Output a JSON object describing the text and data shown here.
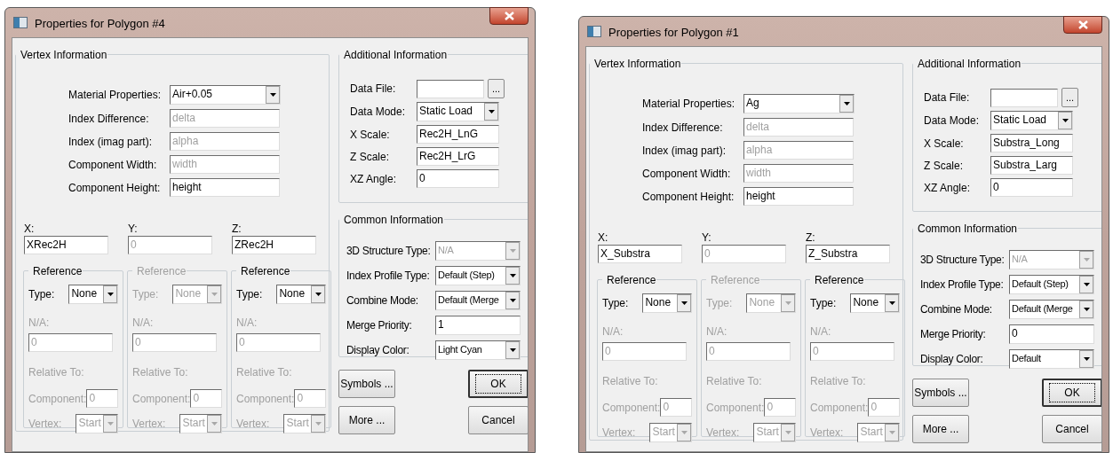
{
  "dialogs": [
    {
      "title": "Properties for Polygon #4",
      "vertex_info": {
        "title": "Vertex Information",
        "fields": [
          {
            "label": "Material Properties:",
            "kind": "dropdown",
            "value": "Air+0.05",
            "disabled": false
          },
          {
            "label": "Index Difference:",
            "kind": "text",
            "value": "delta",
            "disabled": true
          },
          {
            "label": "Index (imag part):",
            "kind": "text",
            "value": "alpha",
            "disabled": true
          },
          {
            "label": "Component Width:",
            "kind": "text",
            "value": "width",
            "disabled": true
          },
          {
            "label": "Component Height:",
            "kind": "text",
            "value": "height",
            "disabled": false
          }
        ],
        "coords": [
          {
            "label": "X:",
            "value": "XRec2H",
            "disabled": false,
            "reference": {
              "title": "Reference",
              "disabled": false,
              "rows": [
                {
                  "kind": "dropdown",
                  "label": "Type:",
                  "value": "None",
                  "disabled": false
                },
                {
                  "kind": "stacked",
                  "label": "N/A:",
                  "value": "0",
                  "disabled": true
                },
                {
                  "kind": "label",
                  "label": "Relative To:",
                  "disabled": true
                },
                {
                  "kind": "inline",
                  "label": "Component:",
                  "value": "0",
                  "disabled": true
                },
                {
                  "kind": "dropdown",
                  "label": "Vertex:",
                  "value": "Start",
                  "disabled": true
                }
              ]
            }
          },
          {
            "label": "Y:",
            "value": "0",
            "disabled": true,
            "reference": {
              "title": "Reference",
              "disabled": true,
              "rows": [
                {
                  "kind": "dropdown",
                  "label": "Type:",
                  "value": "None",
                  "disabled": true
                },
                {
                  "kind": "stacked",
                  "label": "N/A:",
                  "value": "0",
                  "disabled": true
                },
                {
                  "kind": "label",
                  "label": "Relative To:",
                  "disabled": true
                },
                {
                  "kind": "inline",
                  "label": "Component:",
                  "value": "0",
                  "disabled": true
                },
                {
                  "kind": "dropdown",
                  "label": "Vertex:",
                  "value": "Start",
                  "disabled": true
                }
              ]
            }
          },
          {
            "label": "Z:",
            "value": "ZRec2H",
            "disabled": false,
            "reference": {
              "title": "Reference",
              "disabled": false,
              "rows": [
                {
                  "kind": "dropdown",
                  "label": "Type:",
                  "value": "None",
                  "disabled": false
                },
                {
                  "kind": "stacked",
                  "label": "N/A:",
                  "value": "0",
                  "disabled": true
                },
                {
                  "kind": "label",
                  "label": "Relative To:",
                  "disabled": true
                },
                {
                  "kind": "inline",
                  "label": "Component:",
                  "value": "0",
                  "disabled": true
                },
                {
                  "kind": "dropdown",
                  "label": "Vertex:",
                  "value": "Start",
                  "disabled": true
                }
              ]
            }
          }
        ]
      },
      "additional_info": {
        "title": "Additional Information",
        "fields": [
          {
            "label": "Data File:",
            "kind": "file",
            "browse": "..."
          },
          {
            "label": "Data Mode:",
            "kind": "dropdown",
            "value": "Static Load"
          },
          {
            "label": "X Scale:",
            "kind": "text",
            "value": "Rec2H_LnG"
          },
          {
            "label": "Z Scale:",
            "kind": "text",
            "value": "Rec2H_LrG"
          },
          {
            "label": "XZ Angle:",
            "kind": "text",
            "value": "0"
          }
        ]
      },
      "common_info": {
        "title": "Common Information",
        "fields": [
          {
            "label": "3D Structure Type:",
            "kind": "dropdown",
            "value": "N/A",
            "disabled": true
          },
          {
            "label": "Index Profile Type:",
            "kind": "dropdown",
            "value": "Default (Step)",
            "disabled": false
          },
          {
            "label": "Combine Mode:",
            "kind": "dropdown",
            "value": "Default (Merge",
            "disabled": false
          },
          {
            "label": "Merge Priority:",
            "kind": "text",
            "value": "1",
            "disabled": false
          },
          {
            "label": "Display Color:",
            "kind": "dropdown",
            "value": "Light Cyan",
            "disabled": false
          }
        ]
      },
      "buttons": [
        {
          "label": "Symbols ...",
          "default": false
        },
        {
          "label": "OK",
          "default": true
        },
        {
          "label": "More ...",
          "default": false
        },
        {
          "label": "Cancel",
          "default": false
        }
      ]
    },
    {
      "title": "Properties for Polygon #1",
      "vertex_info": {
        "title": "Vertex Information",
        "fields": [
          {
            "label": "Material Properties:",
            "kind": "dropdown",
            "value": "Ag",
            "disabled": false
          },
          {
            "label": "Index Difference:",
            "kind": "text",
            "value": "delta",
            "disabled": true
          },
          {
            "label": "Index (imag part):",
            "kind": "text",
            "value": "alpha",
            "disabled": true
          },
          {
            "label": "Component Width:",
            "kind": "text",
            "value": "width",
            "disabled": true
          },
          {
            "label": "Component Height:",
            "kind": "text",
            "value": "height",
            "disabled": false
          }
        ],
        "coords": [
          {
            "label": "X:",
            "value": "X_Substra",
            "disabled": false,
            "reference": {
              "title": "Reference",
              "disabled": false,
              "rows": [
                {
                  "kind": "dropdown",
                  "label": "Type:",
                  "value": "None",
                  "disabled": false
                },
                {
                  "kind": "stacked",
                  "label": "N/A:",
                  "value": "0",
                  "disabled": true
                },
                {
                  "kind": "label",
                  "label": "Relative To:",
                  "disabled": true
                },
                {
                  "kind": "inline",
                  "label": "Component:",
                  "value": "0",
                  "disabled": true
                },
                {
                  "kind": "dropdown",
                  "label": "Vertex:",
                  "value": "Start",
                  "disabled": true
                }
              ]
            }
          },
          {
            "label": "Y:",
            "value": "0",
            "disabled": true,
            "reference": {
              "title": "Reference",
              "disabled": true,
              "rows": [
                {
                  "kind": "dropdown",
                  "label": "Type:",
                  "value": "None",
                  "disabled": true
                },
                {
                  "kind": "stacked",
                  "label": "N/A:",
                  "value": "0",
                  "disabled": true
                },
                {
                  "kind": "label",
                  "label": "Relative To:",
                  "disabled": true
                },
                {
                  "kind": "inline",
                  "label": "Component:",
                  "value": "0",
                  "disabled": true
                },
                {
                  "kind": "dropdown",
                  "label": "Vertex:",
                  "value": "Start",
                  "disabled": true
                }
              ]
            }
          },
          {
            "label": "Z:",
            "value": "Z_Substra",
            "disabled": false,
            "reference": {
              "title": "Reference",
              "disabled": false,
              "rows": [
                {
                  "kind": "dropdown",
                  "label": "Type:",
                  "value": "None",
                  "disabled": false
                },
                {
                  "kind": "stacked",
                  "label": "N/A:",
                  "value": "0",
                  "disabled": true
                },
                {
                  "kind": "label",
                  "label": "Relative To:",
                  "disabled": true
                },
                {
                  "kind": "inline",
                  "label": "Component:",
                  "value": "0",
                  "disabled": true
                },
                {
                  "kind": "dropdown",
                  "label": "Vertex:",
                  "value": "Start",
                  "disabled": true
                }
              ]
            }
          }
        ]
      },
      "additional_info": {
        "title": "Additional Information",
        "fields": [
          {
            "label": "Data File:",
            "kind": "file",
            "browse": "..."
          },
          {
            "label": "Data Mode:",
            "kind": "dropdown",
            "value": "Static Load"
          },
          {
            "label": "X Scale:",
            "kind": "text",
            "value": "Substra_Long"
          },
          {
            "label": "Z Scale:",
            "kind": "text",
            "value": "Substra_Larg"
          },
          {
            "label": "XZ Angle:",
            "kind": "text",
            "value": "0"
          }
        ]
      },
      "common_info": {
        "title": "Common Information",
        "fields": [
          {
            "label": "3D Structure Type:",
            "kind": "dropdown",
            "value": "N/A",
            "disabled": true
          },
          {
            "label": "Index Profile Type:",
            "kind": "dropdown",
            "value": "Default (Step)",
            "disabled": false
          },
          {
            "label": "Combine Mode:",
            "kind": "dropdown",
            "value": "Default (Merge",
            "disabled": false
          },
          {
            "label": "Merge Priority:",
            "kind": "text",
            "value": "0",
            "disabled": false
          },
          {
            "label": "Display Color:",
            "kind": "dropdown",
            "value": "Default",
            "disabled": false
          }
        ]
      },
      "buttons": [
        {
          "label": "Symbols ...",
          "default": false
        },
        {
          "label": "OK",
          "default": true
        },
        {
          "label": "More ...",
          "default": false
        },
        {
          "label": "Cancel",
          "default": false
        }
      ]
    }
  ]
}
